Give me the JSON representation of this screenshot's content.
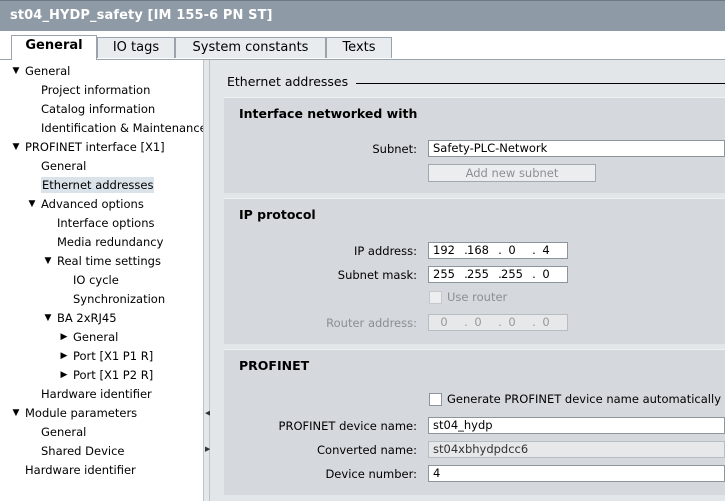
{
  "window": {
    "title": "st04_HYDP_safety [IM 155-6 PN ST]"
  },
  "tabs": [
    {
      "label": "General",
      "active": true
    },
    {
      "label": "IO tags",
      "active": false
    },
    {
      "label": "System constants",
      "active": false
    },
    {
      "label": "Texts",
      "active": false
    }
  ],
  "tree": [
    {
      "label": "General",
      "arrow": "▼"
    },
    {
      "label": "Project information",
      "arrow": ""
    },
    {
      "label": "Catalog information",
      "arrow": ""
    },
    {
      "label": "Identification & Maintenance",
      "arrow": ""
    },
    {
      "label": "PROFINET interface [X1]",
      "arrow": "▼"
    },
    {
      "label": "General",
      "arrow": ""
    },
    {
      "label": "Ethernet addresses",
      "arrow": "",
      "selected": true
    },
    {
      "label": "Advanced options",
      "arrow": "▼"
    },
    {
      "label": "Interface options",
      "arrow": ""
    },
    {
      "label": "Media redundancy",
      "arrow": ""
    },
    {
      "label": "Real time settings",
      "arrow": "▼"
    },
    {
      "label": "IO cycle",
      "arrow": ""
    },
    {
      "label": "Synchronization",
      "arrow": ""
    },
    {
      "label": "BA 2xRJ45",
      "arrow": "▼"
    },
    {
      "label": "General",
      "arrow": "▶"
    },
    {
      "label": "Port [X1 P1 R]",
      "arrow": "▶"
    },
    {
      "label": "Port [X1 P2 R]",
      "arrow": "▶"
    },
    {
      "label": "Hardware identifier",
      "arrow": ""
    },
    {
      "label": "Module parameters",
      "arrow": "▼"
    },
    {
      "label": "General",
      "arrow": ""
    },
    {
      "label": "Shared Device",
      "arrow": ""
    },
    {
      "label": "Hardware identifier",
      "arrow": ""
    }
  ],
  "section": {
    "title": "Ethernet addresses"
  },
  "interface": {
    "title": "Interface networked with",
    "subnet_label": "Subnet:",
    "subnet_value": "Safety-PLC-Network",
    "add_subnet_label": "Add new subnet"
  },
  "ip": {
    "title": "IP protocol",
    "ip_label": "IP address:",
    "ip_parts": [
      "192",
      "168",
      "0",
      "4"
    ],
    "mask_label": "Subnet mask:",
    "mask_parts": [
      "255",
      "255",
      "255",
      "0"
    ],
    "use_router_label": "Use router",
    "router_label": "Router address:",
    "router_parts": [
      "0",
      "0",
      "0",
      "0"
    ]
  },
  "profinet": {
    "title": "PROFINET",
    "auto_name_label": "Generate PROFINET device name automatically",
    "device_name_label": "PROFINET device name:",
    "device_name_value": "st04_hydp",
    "converted_label": "Converted name:",
    "converted_value": "st04xbhydpdcc6",
    "device_number_label": "Device number:",
    "device_number_value": "4"
  }
}
